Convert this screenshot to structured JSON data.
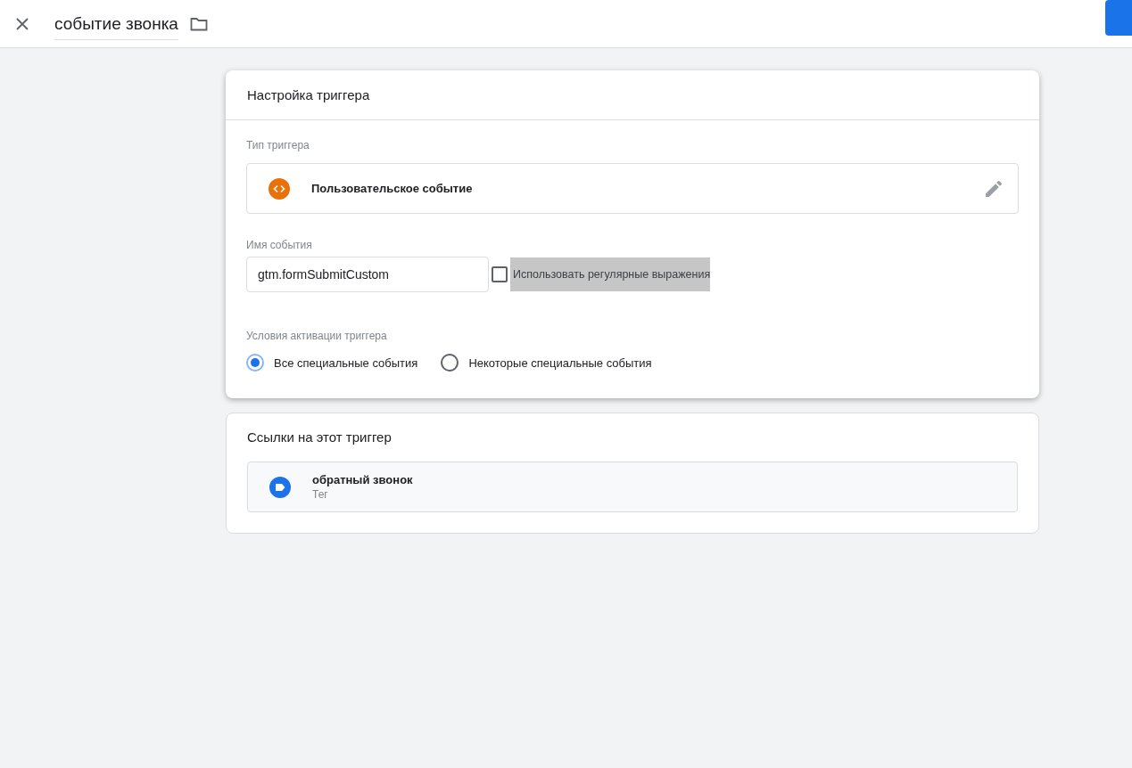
{
  "header": {
    "title": "событие звонка"
  },
  "trigger_config": {
    "title": "Настройка триггера",
    "type_label": "Тип триггера",
    "type_value": "Пользовательское событие",
    "event_name_label": "Имя события",
    "event_name_value": "gtm.formSubmitCustom",
    "regex_checkbox": {
      "label": "Использовать регулярные выражения",
      "checked": false,
      "highlighted": true
    },
    "conditions_label": "Условия активации триггера",
    "conditions": [
      {
        "label": "Все специальные события",
        "selected": true
      },
      {
        "label": "Некоторые специальные события",
        "selected": false
      }
    ]
  },
  "references": {
    "title": "Ссылки на этот триггер",
    "items": [
      {
        "name": "обратный звонок",
        "type": "Тег"
      }
    ]
  }
}
